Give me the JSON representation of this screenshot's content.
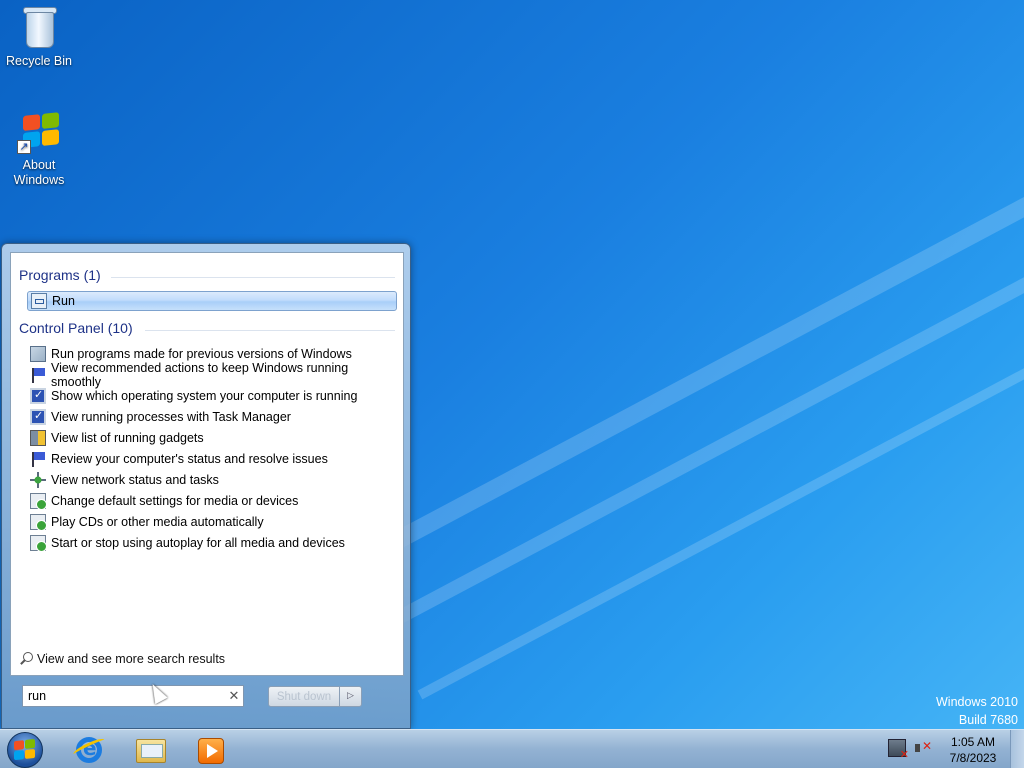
{
  "desktop": {
    "icons": [
      {
        "label": "Recycle Bin",
        "icon": "recycle-bin-icon"
      },
      {
        "label": "About Windows",
        "icon": "windows-logo-icon"
      }
    ],
    "watermark": {
      "line1": "Windows 2010",
      "line2": "Build 7680"
    }
  },
  "start_menu": {
    "groups": [
      {
        "title": "Programs (1)",
        "items": [
          {
            "label": "Run",
            "icon": "run-icon",
            "selected": true
          }
        ]
      },
      {
        "title": "Control Panel (10)",
        "items": [
          {
            "label": "Run programs made for previous versions of Windows",
            "icon": "compatibility-icon"
          },
          {
            "label": "View recommended actions to keep Windows running smoothly",
            "icon": "action-center-flag-icon"
          },
          {
            "label": "Show which operating system your computer is running",
            "icon": "system-monitor-icon"
          },
          {
            "label": "View running processes with Task Manager",
            "icon": "system-monitor-icon"
          },
          {
            "label": "View list of running gadgets",
            "icon": "gadgets-icon"
          },
          {
            "label": "Review your computer's status and resolve issues",
            "icon": "action-center-flag-icon"
          },
          {
            "label": "View network status and tasks",
            "icon": "network-icon"
          },
          {
            "label": "Change default settings for media or devices",
            "icon": "autoplay-icon"
          },
          {
            "label": "Play CDs or other media automatically",
            "icon": "autoplay-icon"
          },
          {
            "label": "Start or stop using autoplay for all media and devices",
            "icon": "autoplay-icon"
          }
        ]
      }
    ],
    "more_results_label": "View and see more search results",
    "search": {
      "value": "run",
      "placeholder": ""
    },
    "shutdown_label": "Shut down"
  },
  "taskbar": {
    "pinned": [
      {
        "name": "Internet Explorer",
        "icon": "internet-explorer-icon"
      },
      {
        "name": "Windows Explorer",
        "icon": "folder-icon"
      },
      {
        "name": "Windows Media Player",
        "icon": "media-player-icon"
      }
    ],
    "clock": {
      "time": "1:05 AM",
      "date": "7/8/2023"
    }
  },
  "colors": {
    "desktop_bg": "#1a7fe0",
    "group_title": "#1e3287",
    "selection": "#c1dcfc"
  }
}
